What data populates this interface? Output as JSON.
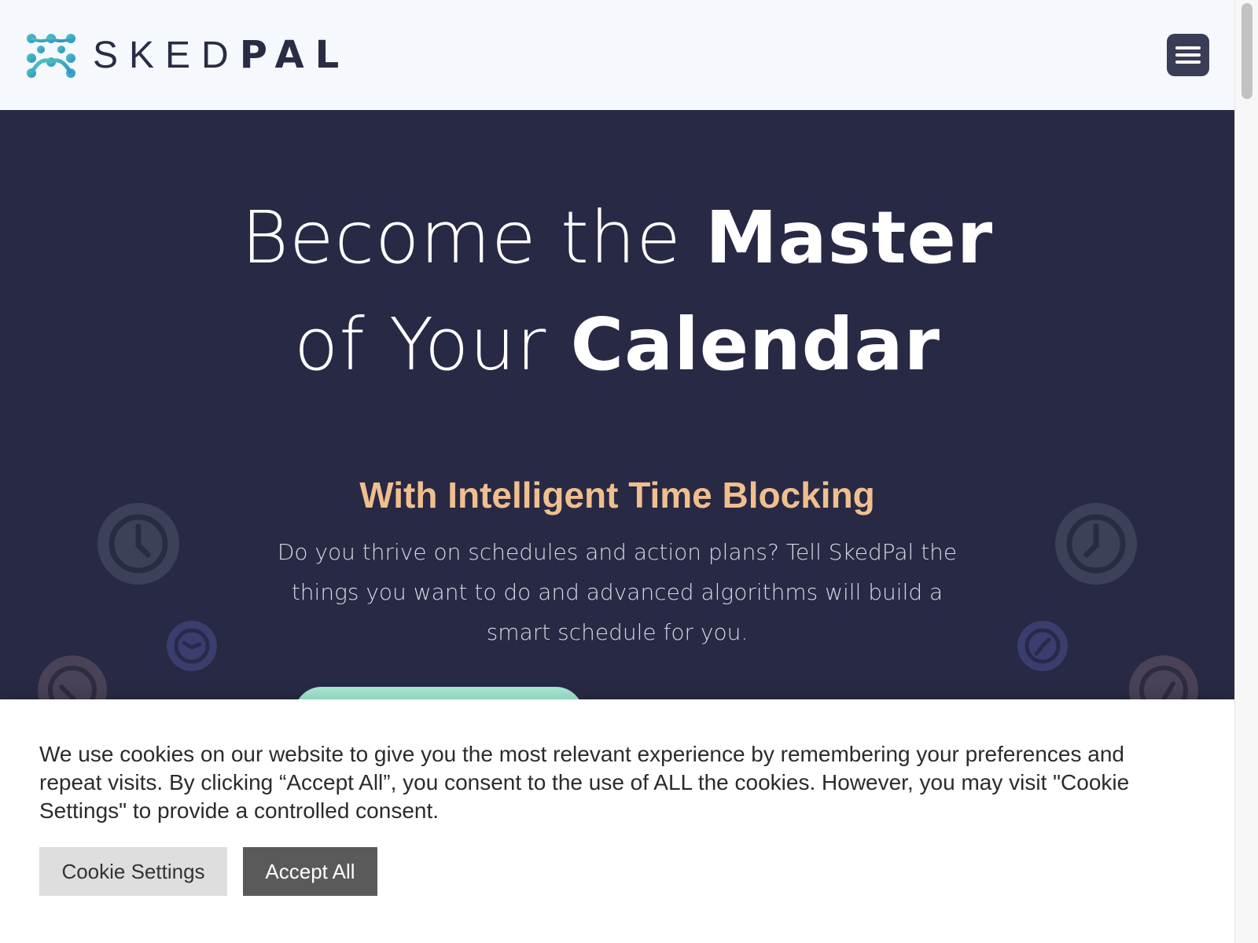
{
  "header": {
    "logo_text_light": "SKED",
    "logo_text_bold": "PAL",
    "menu_icon": "hamburger-icon"
  },
  "hero": {
    "title_line1_light": "Become the ",
    "title_line1_bold": "Master",
    "title_line2_light": "of Your ",
    "title_line2_bold": "Calendar",
    "subtitle": "With Intelligent Time Blocking",
    "description": "Do you thrive on schedules and action plans? Tell SkedPal the things you want to do and advanced algorithms will build a smart schedule for you.",
    "decorative_icons": [
      "clock-icon"
    ]
  },
  "cookie_banner": {
    "message": "We use cookies on our website to give you the most relevant experience by remembering your preferences and repeat visits. By clicking “Accept All”, you consent to the use of ALL the cookies. However, you may visit \"Cookie Settings\" to provide a controlled consent.",
    "settings_label": "Cookie Settings",
    "accept_label": "Accept All"
  },
  "colors": {
    "header_bg": "#f5f8fc",
    "hero_bg": "#282945",
    "subtitle": "#f0bf8e",
    "cta": "#a6ead4",
    "menu_button": "#3a3d56",
    "logo_teal": "#3bb8c4"
  }
}
